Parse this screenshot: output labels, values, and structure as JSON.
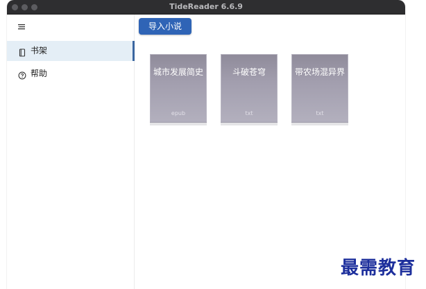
{
  "window": {
    "title": "TideReader 6.6.9"
  },
  "sidebar": {
    "items": [
      {
        "label": "书架",
        "icon": "book-icon",
        "active": true
      },
      {
        "label": "帮助",
        "icon": "help-circle-icon",
        "active": false
      }
    ]
  },
  "main": {
    "import_button": "导入小说",
    "books": [
      {
        "title": "城市发展简史",
        "format": "epub"
      },
      {
        "title": "斗破苍穹",
        "format": "txt"
      },
      {
        "title": "带农场混异界",
        "format": "txt"
      }
    ]
  },
  "watermark": {
    "text": "最需教育"
  },
  "colors": {
    "titlebar": "#2e2e30",
    "accent": "#2f64b6",
    "active_bg": "#e4eef6",
    "active_border": "#3a66a0",
    "cover": "#a29eae",
    "watermark": "#1d2f9c"
  }
}
